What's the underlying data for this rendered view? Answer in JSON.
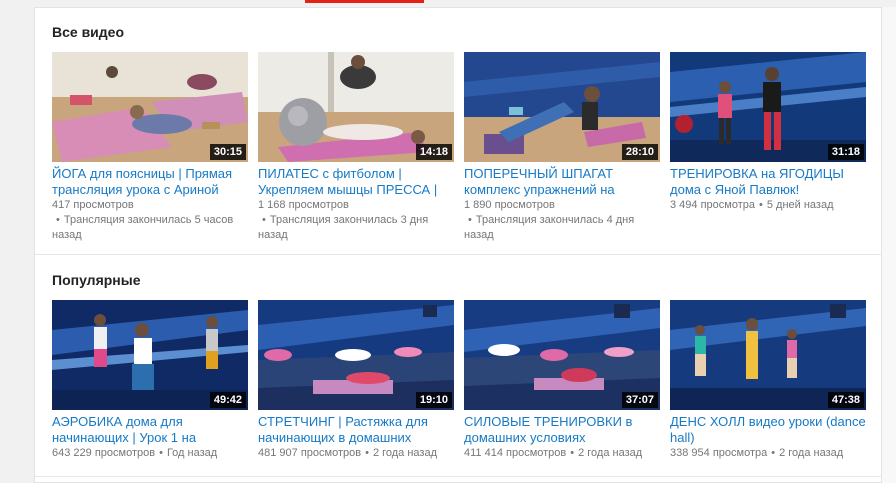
{
  "shelves": [
    {
      "title": "Все видео",
      "videos": [
        {
          "title": "ЙОГА для поясницы | Прямая трансляция урока с Ариной",
          "duration": "30:15",
          "views": "417 просмотров",
          "age": "Трансляция закончилась 5 часов назад"
        },
        {
          "title": "ПИЛАТЕС с фитболом | Укрепляем мышцы ПРЕССА |",
          "duration": "14:18",
          "views": "1 168 просмотров",
          "age": "Трансляция закончилась 3 дня назад"
        },
        {
          "title": "ПОПЕРЕЧНЫЙ ШПАГАТ комплекс упражнений на",
          "duration": "28:10",
          "views": "1 890 просмотров",
          "age": "Трансляция закончилась 4 дня назад"
        },
        {
          "title": "ТРЕНИРОВКА на ЯГОДИЦЫ дома с Яной Павлюк!",
          "duration": "31:18",
          "views": "3 494 просмотра",
          "age": "5 дней назад"
        }
      ]
    },
    {
      "title": "Популярные",
      "videos": [
        {
          "title": "АЭРОБИКА дома для начинающих | Урок 1 на",
          "duration": "49:42",
          "views": "643 229 просмотров",
          "age": "Год назад"
        },
        {
          "title": "СТРЕТЧИНГ | Растяжка для начинающих в домашних",
          "duration": "19:10",
          "views": "481 907 просмотров",
          "age": "2 года назад"
        },
        {
          "title": "СИЛОВЫЕ ТРЕНИРОВКИ в домашних условиях",
          "duration": "37:07",
          "views": "411 414 просмотров",
          "age": "2 года назад"
        },
        {
          "title": "ДЕНС ХОЛЛ видео уроки (dance hall)",
          "duration": "47:38",
          "views": "338 954 просмотра",
          "age": "2 года назад"
        }
      ]
    }
  ],
  "icons": {
    "next": "chevron-right-icon"
  },
  "colors": {
    "link": "#167ac6",
    "meta": "#767676",
    "accent": "#e62117"
  }
}
